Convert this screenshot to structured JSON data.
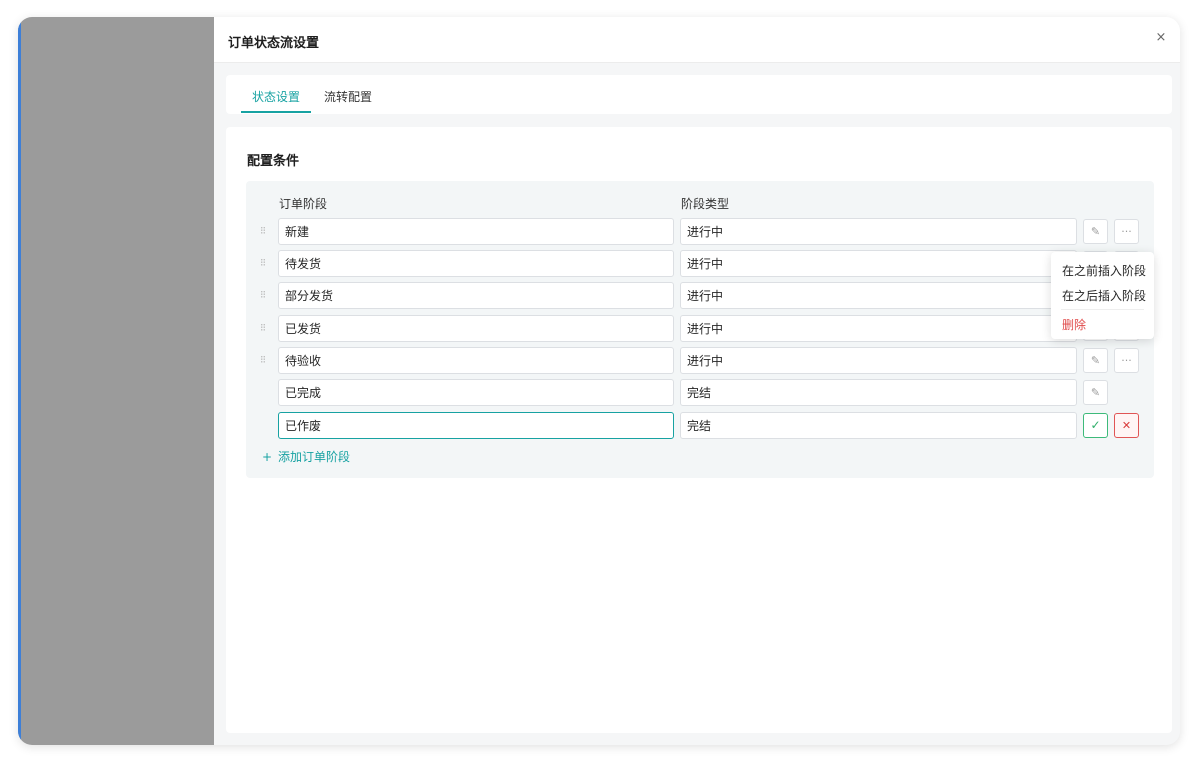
{
  "drawer": {
    "title": "订单状态流设置",
    "close_icon": "×"
  },
  "tabs": [
    {
      "label": "状态设置",
      "active": true
    },
    {
      "label": "流转配置",
      "active": false
    }
  ],
  "section": {
    "title": "配置条件"
  },
  "columns": {
    "stage": "订单阶段",
    "type": "阶段类型"
  },
  "rows": [
    {
      "name": "新建",
      "type": "进行中",
      "draggable": true,
      "actions": [
        "edit",
        "more"
      ]
    },
    {
      "name": "待发货",
      "type": "进行中",
      "draggable": true,
      "actions": [
        "edit",
        "more"
      ]
    },
    {
      "name": "部分发货",
      "type": "进行中",
      "draggable": true,
      "actions": [
        "edit",
        "more"
      ]
    },
    {
      "name": "已发货",
      "type": "进行中",
      "draggable": true,
      "actions": [
        "edit",
        "more"
      ]
    },
    {
      "name": "待验收",
      "type": "进行中",
      "draggable": true,
      "actions": [
        "edit",
        "more"
      ]
    },
    {
      "name": "已完成",
      "type": "完结",
      "draggable": false,
      "actions": [
        "edit"
      ]
    },
    {
      "name": "已作废",
      "type": "完结",
      "draggable": false,
      "actions": [
        "confirm",
        "cancel"
      ],
      "editing": true
    }
  ],
  "add_stage": {
    "icon": "+",
    "label": "添加订单阶段"
  },
  "context_menu": {
    "items": [
      {
        "label": "在之前插入阶段"
      },
      {
        "label": "在之后插入阶段"
      },
      {
        "label": "删除",
        "danger": true
      }
    ]
  },
  "icons": {
    "drag": "⁝⁝",
    "edit": "✎",
    "more": "···",
    "confirm": "✓",
    "cancel": "✕"
  },
  "colors": {
    "accent": "#17a2a2",
    "danger": "#e04a4a",
    "success": "#2fae6a"
  }
}
